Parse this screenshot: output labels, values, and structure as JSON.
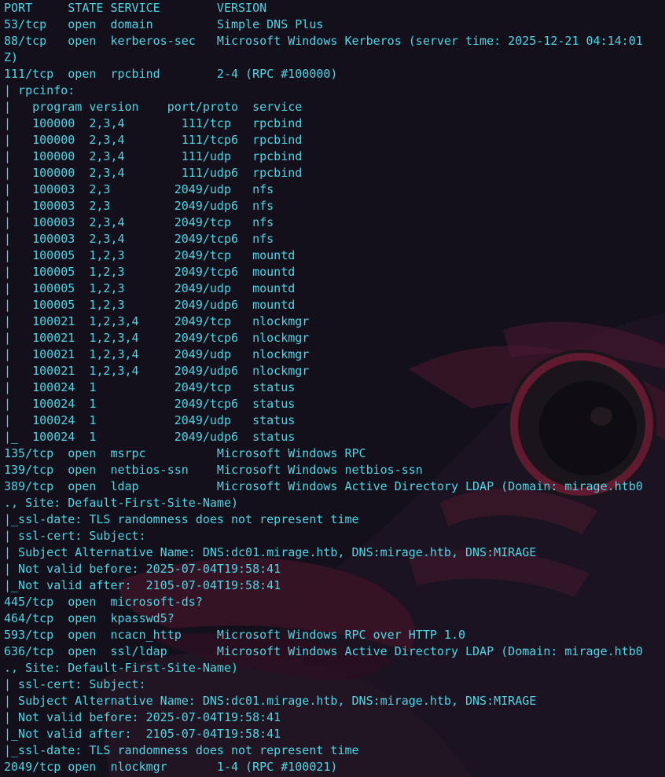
{
  "terminal": {
    "text_color": "#4fd6e4",
    "background_color": "#13101c",
    "lines": [
      "PORT     STATE SERVICE        VERSION",
      "53/tcp   open  domain         Simple DNS Plus",
      "88/tcp   open  kerberos-sec   Microsoft Windows Kerberos (server time: 2025-12-21 04:14:01",
      "Z)",
      "111/tcp  open  rpcbind        2-4 (RPC #100000)",
      "| rpcinfo:",
      "|   program version    port/proto  service",
      "|   100000  2,3,4        111/tcp   rpcbind",
      "|   100000  2,3,4        111/tcp6  rpcbind",
      "|   100000  2,3,4        111/udp   rpcbind",
      "|   100000  2,3,4        111/udp6  rpcbind",
      "|   100003  2,3         2049/udp   nfs",
      "|   100003  2,3         2049/udp6  nfs",
      "|   100003  2,3,4       2049/tcp   nfs",
      "|   100003  2,3,4       2049/tcp6  nfs",
      "|   100005  1,2,3       2049/tcp   mountd",
      "|   100005  1,2,3       2049/tcp6  mountd",
      "|   100005  1,2,3       2049/udp   mountd",
      "|   100005  1,2,3       2049/udp6  mountd",
      "|   100021  1,2,3,4     2049/tcp   nlockmgr",
      "|   100021  1,2,3,4     2049/tcp6  nlockmgr",
      "|   100021  1,2,3,4     2049/udp   nlockmgr",
      "|   100021  1,2,3,4     2049/udp6  nlockmgr",
      "|   100024  1           2049/tcp   status",
      "|   100024  1           2049/tcp6  status",
      "|   100024  1           2049/udp   status",
      "|_  100024  1           2049/udp6  status",
      "135/tcp  open  msrpc          Microsoft Windows RPC",
      "139/tcp  open  netbios-ssn    Microsoft Windows netbios-ssn",
      "389/tcp  open  ldap           Microsoft Windows Active Directory LDAP (Domain: mirage.htb0",
      "., Site: Default-First-Site-Name)",
      "|_ssl-date: TLS randomness does not represent time",
      "| ssl-cert: Subject:",
      "| Subject Alternative Name: DNS:dc01.mirage.htb, DNS:mirage.htb, DNS:MIRAGE",
      "| Not valid before: 2025-07-04T19:58:41",
      "|_Not valid after:  2105-07-04T19:58:41",
      "445/tcp  open  microsoft-ds?",
      "464/tcp  open  kpasswd5?",
      "593/tcp  open  ncacn_http     Microsoft Windows RPC over HTTP 1.0",
      "636/tcp  open  ssl/ldap       Microsoft Windows Active Directory LDAP (Domain: mirage.htb0",
      "., Site: Default-First-Site-Name)",
      "| ssl-cert: Subject:",
      "| Subject Alternative Name: DNS:dc01.mirage.htb, DNS:mirage.htb, DNS:MIRAGE",
      "| Not valid before: 2025-07-04T19:58:41",
      "|_Not valid after:  2105-07-04T19:58:41",
      "|_ssl-date: TLS randomness does not represent time",
      "2049/tcp open  nlockmgr       1-4 (RPC #100021)"
    ]
  }
}
